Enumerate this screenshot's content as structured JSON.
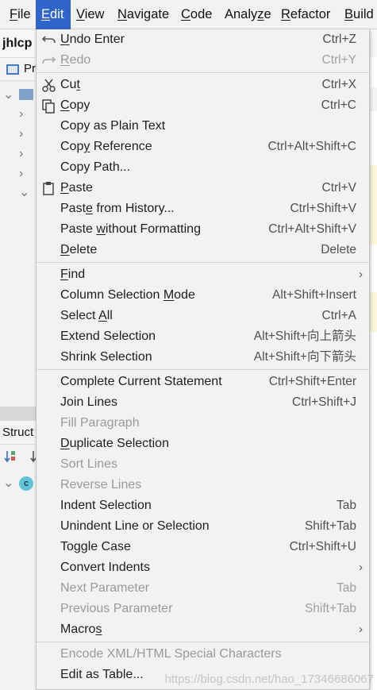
{
  "menubar": {
    "items": [
      {
        "label": "File",
        "mnemonic": "F"
      },
      {
        "label": "Edit",
        "mnemonic": "E",
        "active": true
      },
      {
        "label": "View",
        "mnemonic": "V"
      },
      {
        "label": "Navigate",
        "mnemonic": "N"
      },
      {
        "label": "Code",
        "mnemonic": "C"
      },
      {
        "label": "Analyze",
        "mnemonic": "z"
      },
      {
        "label": "Refactor",
        "mnemonic": "R"
      },
      {
        "label": "Build",
        "mnemonic": "B"
      }
    ]
  },
  "background": {
    "project_title": "jhlcp",
    "project_tab": "Pr",
    "structure_tab": "Struct",
    "class_badge": "c"
  },
  "edit_menu": {
    "groups": [
      [
        {
          "label": "Undo Enter",
          "mnemonic_index": 0,
          "shortcut": "Ctrl+Z",
          "icon": "undo-icon"
        },
        {
          "label": "Redo",
          "mnemonic_index": 0,
          "shortcut": "Ctrl+Y",
          "icon": "redo-icon",
          "disabled": true
        }
      ],
      [
        {
          "label": "Cut",
          "mnemonic_index": 2,
          "shortcut": "Ctrl+X",
          "icon": "scissors-icon"
        },
        {
          "label": "Copy",
          "mnemonic_index": 0,
          "shortcut": "Ctrl+C",
          "icon": "copy-icon"
        },
        {
          "label": "Copy as Plain Text",
          "shortcut": ""
        },
        {
          "label": "Copy Reference",
          "mnemonic_index": 3,
          "shortcut": "Ctrl+Alt+Shift+C"
        },
        {
          "label": "Copy Path...",
          "shortcut": ""
        },
        {
          "label": "Paste",
          "mnemonic_index": 0,
          "shortcut": "Ctrl+V",
          "icon": "clipboard-icon"
        },
        {
          "label": "Paste from History...",
          "mnemonic_index": 4,
          "shortcut": "Ctrl+Shift+V"
        },
        {
          "label": "Paste without Formatting",
          "mnemonic_index": 6,
          "shortcut": "Ctrl+Alt+Shift+V"
        },
        {
          "label": "Delete",
          "mnemonic_index": 0,
          "shortcut": "Delete"
        }
      ],
      [
        {
          "label": "Find",
          "mnemonic_index": 0,
          "shortcut": "",
          "submenu": true
        },
        {
          "label": "Column Selection Mode",
          "mnemonic_index": 17,
          "shortcut": "Alt+Shift+Insert"
        },
        {
          "label": "Select All",
          "mnemonic_index": 7,
          "shortcut": "Ctrl+A"
        },
        {
          "label": "Extend Selection",
          "shortcut": "Alt+Shift+向上箭头"
        },
        {
          "label": "Shrink Selection",
          "shortcut": "Alt+Shift+向下箭头"
        }
      ],
      [
        {
          "label": "Complete Current Statement",
          "shortcut": "Ctrl+Shift+Enter"
        },
        {
          "label": "Join Lines",
          "shortcut": "Ctrl+Shift+J"
        },
        {
          "label": "Fill Paragraph",
          "shortcut": "",
          "disabled": true
        },
        {
          "label": "Duplicate Selection",
          "mnemonic_index": 0,
          "shortcut": ""
        },
        {
          "label": "Sort Lines",
          "shortcut": "",
          "disabled": true
        },
        {
          "label": "Reverse Lines",
          "shortcut": "",
          "disabled": true
        },
        {
          "label": "Indent Selection",
          "shortcut": "Tab"
        },
        {
          "label": "Unindent Line or Selection",
          "shortcut": "Shift+Tab"
        },
        {
          "label": "Toggle Case",
          "shortcut": "Ctrl+Shift+U"
        },
        {
          "label": "Convert Indents",
          "shortcut": "",
          "submenu": true
        },
        {
          "label": "Next Parameter",
          "shortcut": "Tab",
          "disabled": true
        },
        {
          "label": "Previous Parameter",
          "shortcut": "Shift+Tab",
          "disabled": true
        },
        {
          "label": "Macros",
          "mnemonic_index": 5,
          "shortcut": "",
          "submenu": true
        }
      ],
      [
        {
          "label": "Encode XML/HTML Special Characters",
          "shortcut": "",
          "disabled": true
        },
        {
          "label": "Edit as Table...",
          "shortcut": ""
        }
      ]
    ]
  },
  "watermark": "https://blog.csdn.net/hao_17346686067"
}
